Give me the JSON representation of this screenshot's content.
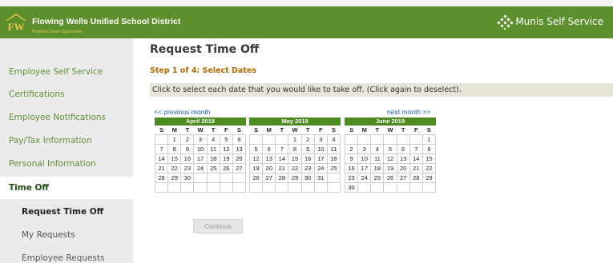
{
  "header": {
    "district_name": "Flowing Wells Unified School District",
    "tagline": "Potential Grows Opportunity",
    "app_name": "Munis Self Service",
    "colors": {
      "header_bg": "#5d8f2d",
      "accent": "#b36a00",
      "link": "#1a5fb4"
    }
  },
  "sidebar": {
    "items": [
      {
        "label": "Employee Self Service"
      },
      {
        "label": "Certifications"
      },
      {
        "label": "Employee Notifications"
      },
      {
        "label": "Pay/Tax Information"
      },
      {
        "label": "Personal Information"
      },
      {
        "label": "Time Off"
      }
    ],
    "subitems": [
      {
        "label": "Request Time Off"
      },
      {
        "label": "My Requests"
      },
      {
        "label": "Employee Requests"
      }
    ]
  },
  "main": {
    "title": "Request Time Off",
    "step": "Step 1 of 4: Select Dates",
    "instructions": "Click to select each date that you would like to take off. (Click again to deselect).",
    "prev_link": "<< previous month",
    "next_link": "next month >>",
    "continue_label": "Continue"
  },
  "weekdays": [
    "S",
    "M",
    "T",
    "W",
    "T",
    "F",
    "S"
  ],
  "calendars": [
    {
      "title": "April 2019",
      "weeks": [
        [
          "",
          "1",
          "2",
          "3",
          "4",
          "5",
          "6"
        ],
        [
          "7",
          "8",
          "9",
          "10",
          "11",
          "12",
          "13"
        ],
        [
          "14",
          "15",
          "16",
          "17",
          "18",
          "19",
          "20"
        ],
        [
          "21",
          "22",
          "23",
          "24",
          "25",
          "26",
          "27"
        ],
        [
          "28",
          "29",
          "30",
          "",
          "",
          "",
          ""
        ],
        [
          "",
          "",
          "",
          "",
          "",
          "",
          ""
        ]
      ]
    },
    {
      "title": "May 2019",
      "weeks": [
        [
          "",
          "",
          "",
          "1",
          "2",
          "3",
          "4"
        ],
        [
          "5",
          "6",
          "7",
          "8",
          "9",
          "10",
          "11"
        ],
        [
          "12",
          "13",
          "14",
          "15",
          "16",
          "17",
          "18"
        ],
        [
          "19",
          "20",
          "21",
          "22",
          "23",
          "24",
          "25"
        ],
        [
          "26",
          "27",
          "28",
          "29",
          "30",
          "31",
          ""
        ],
        [
          "",
          "",
          "",
          "",
          "",
          "",
          ""
        ]
      ]
    },
    {
      "title": "June 2019",
      "weeks": [
        [
          "",
          "",
          "",
          "",
          "",
          "",
          "1"
        ],
        [
          "2",
          "3",
          "4",
          "5",
          "6",
          "7",
          "8"
        ],
        [
          "9",
          "10",
          "11",
          "12",
          "13",
          "14",
          "15"
        ],
        [
          "16",
          "17",
          "18",
          "19",
          "20",
          "21",
          "22"
        ],
        [
          "23",
          "24",
          "25",
          "26",
          "27",
          "28",
          "29"
        ],
        [
          "30",
          "",
          "",
          "",
          "",
          "",
          ""
        ]
      ]
    }
  ]
}
